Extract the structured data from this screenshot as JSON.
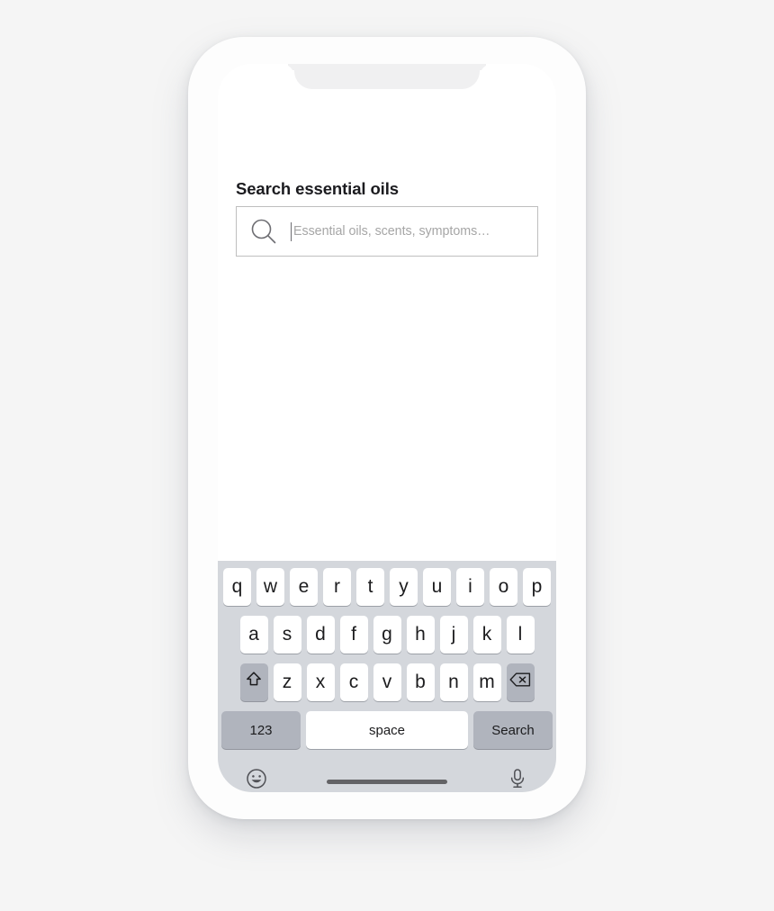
{
  "device": {
    "type": "smartphone-mockup",
    "notch": true,
    "home_indicator": true
  },
  "app": {
    "title": "Search essential oils",
    "search": {
      "placeholder": "Essential oils, scents, symptoms…",
      "value": "",
      "focused": true,
      "icon": "search-icon"
    }
  },
  "keyboard": {
    "layout": "qwerty-lowercase",
    "row1": [
      "q",
      "w",
      "e",
      "r",
      "t",
      "y",
      "u",
      "i",
      "o",
      "p"
    ],
    "row2": [
      "a",
      "s",
      "d",
      "f",
      "g",
      "h",
      "j",
      "k",
      "l"
    ],
    "row3": [
      "z",
      "x",
      "c",
      "v",
      "b",
      "n",
      "m"
    ],
    "shift_icon": "shift-icon",
    "backspace_icon": "backspace-icon",
    "numeric_label": "123",
    "space_label": "space",
    "action_label": "Search",
    "emoji_icon": "emoji-icon",
    "mic_icon": "microphone-icon"
  },
  "colors": {
    "page_background": "#f5f5f5",
    "phone_body": "#fdfdfd",
    "screen": "#ffffff",
    "notch": "#f0f0f1",
    "keyboard_background": "#d4d7dc",
    "key_face": "#ffffff",
    "key_function": "#b0b4bd",
    "text_primary": "#1b1b1f",
    "text_placeholder": "#a6a6a6",
    "input_border": "#bfbfbf",
    "home_indicator": "#636366",
    "icon_gray": "#6d6d72"
  }
}
